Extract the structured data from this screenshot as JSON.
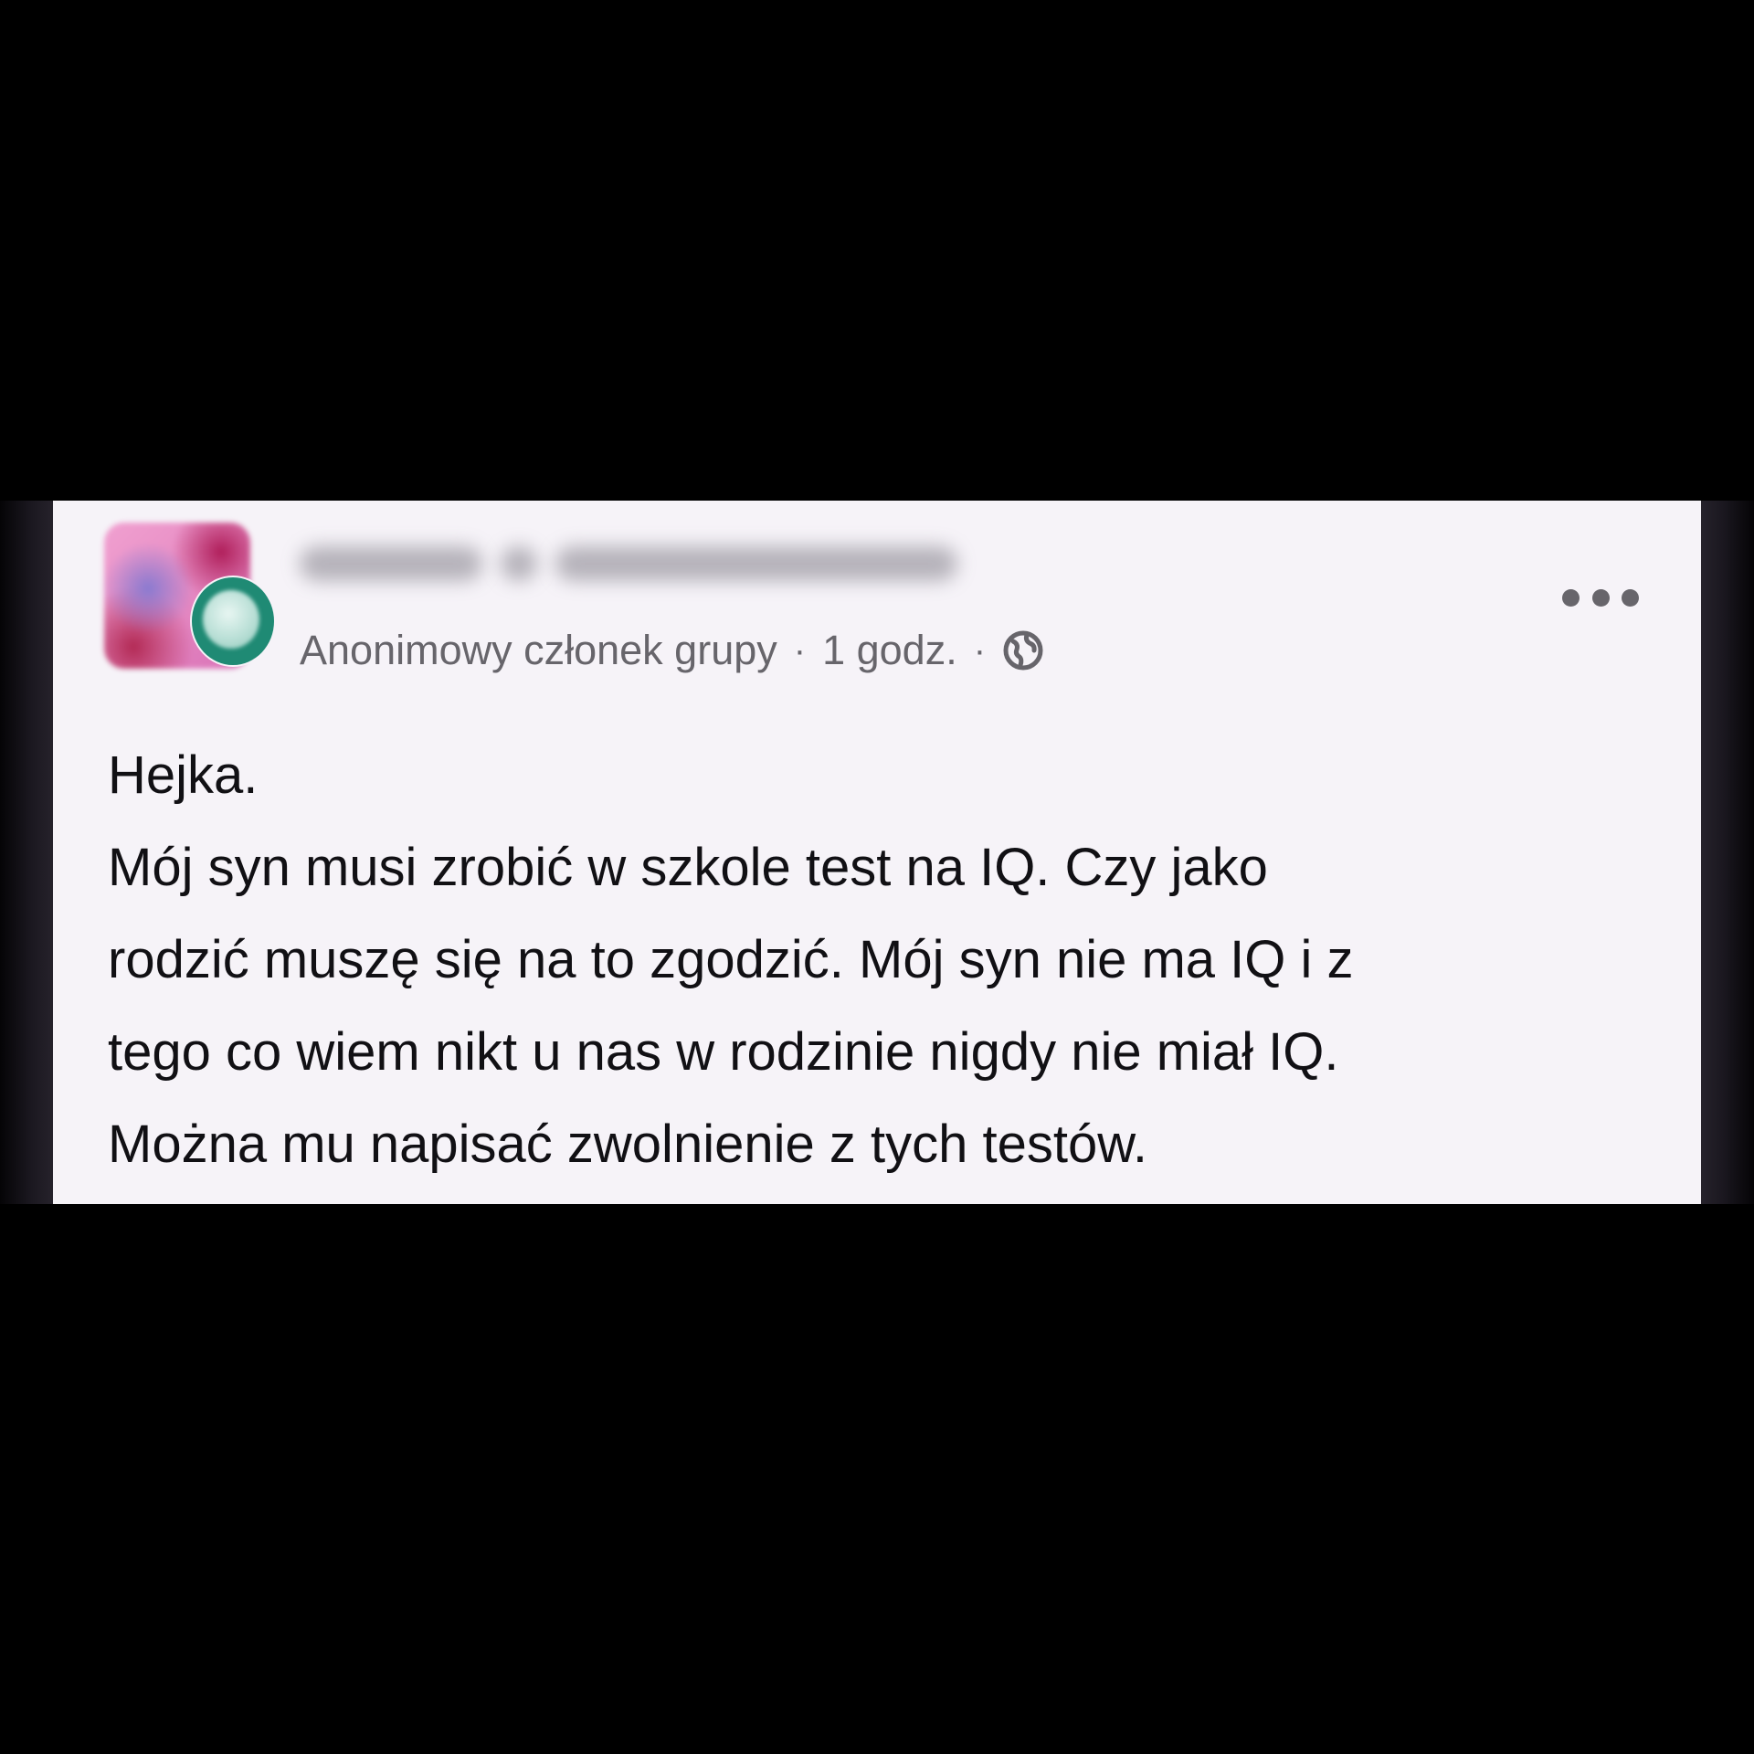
{
  "post": {
    "author_visibility": "Anonimowy członek grupy",
    "separator": "·",
    "timestamp": "1 godz.",
    "audience_icon": "globe-icon",
    "more_icon": "more-options-icon",
    "body_lines": [
      "Hejka.",
      "Mój syn musi zrobić w szkole test na IQ. Czy jako",
      "rodzić muszę się na to zgodzić. Mój syn nie ma IQ i z",
      "tego co wiem nikt u nas w rodzinie nigdy nie miał IQ.",
      "Można mu napisać zwolnienie z tych testów."
    ]
  },
  "colors": {
    "background": "#000000",
    "card": "#f6f3f8",
    "text": "#111014",
    "meta_text": "#67656b"
  }
}
